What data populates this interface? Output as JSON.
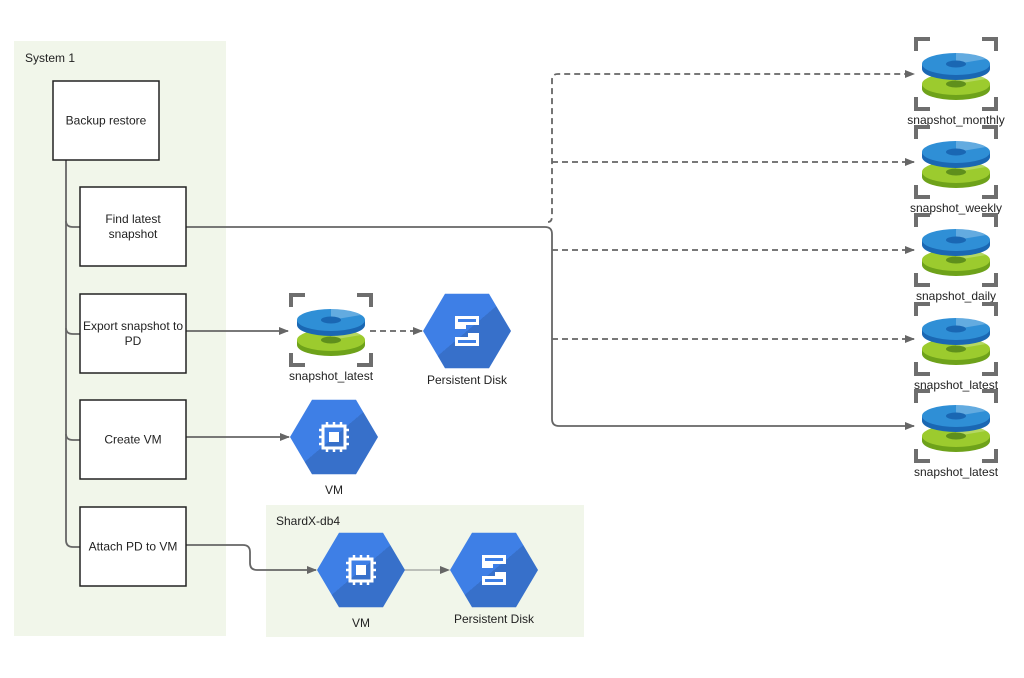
{
  "colors": {
    "group_bg": "#f1f6ea",
    "edge": "#666666",
    "hex_blue": "#3e7fe6",
    "disk_blue": "#2f8fd6",
    "disk_blue_dark": "#1a67b3",
    "disk_green": "#9ccb2e",
    "disk_green_dark": "#6ea21a",
    "bracket": "#6e6e6e"
  },
  "groups": [
    {
      "id": "system1",
      "title": "System 1"
    },
    {
      "id": "shardx",
      "title": "ShardX-db4"
    }
  ],
  "steps": [
    {
      "id": "backup",
      "lines": [
        "Backup restore"
      ]
    },
    {
      "id": "find",
      "lines": [
        "Find latest",
        "snapshot"
      ]
    },
    {
      "id": "export",
      "lines": [
        "Export snapshot to",
        "PD"
      ]
    },
    {
      "id": "createvm",
      "lines": [
        "Create VM"
      ]
    },
    {
      "id": "attach",
      "lines": [
        "Attach PD to VM"
      ]
    }
  ],
  "nodes": {
    "mid_snapshot": {
      "icon": "snapshot-icon",
      "label": "snapshot_latest"
    },
    "mid_pd": {
      "icon": "persistent-disk-icon",
      "label": "Persistent Disk"
    },
    "mid_vm": {
      "icon": "compute-engine-vm-icon",
      "label": "VM"
    },
    "shard_vm": {
      "icon": "compute-engine-vm-icon",
      "label": "VM"
    },
    "shard_pd": {
      "icon": "persistent-disk-icon",
      "label": "Persistent Disk"
    }
  },
  "snapshots_right": [
    {
      "label": "snapshot_monthly",
      "edge": "dashed"
    },
    {
      "label": "snapshot_weekly",
      "edge": "dashed"
    },
    {
      "label": "snapshot_daily",
      "edge": "dashed"
    },
    {
      "label": "snapshot_latest",
      "edge": "dashed"
    },
    {
      "label": "snapshot_latest",
      "edge": "solid"
    }
  ]
}
